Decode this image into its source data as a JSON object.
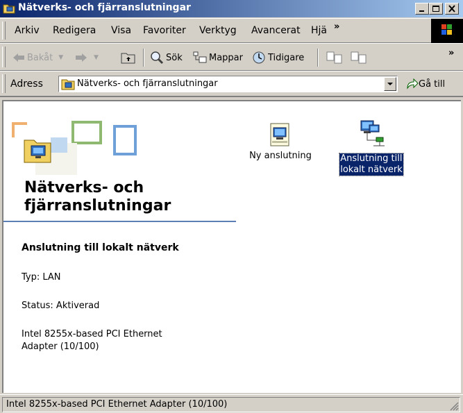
{
  "window": {
    "title": "Nätverks- och fjärranslutningar"
  },
  "menu": [
    "Arkiv",
    "Redigera",
    "Visa",
    "Favoriter",
    "Verktyg",
    "Avancerat",
    "Hjä"
  ],
  "toolbar": {
    "back": "Bakåt",
    "search": "Sök",
    "folders": "Mappar",
    "history": "Tidigare"
  },
  "address": {
    "label": "Adress",
    "value": "Nätverks- och fjärranslutningar",
    "go": "Gå till"
  },
  "panel": {
    "title_line1": "Nätverks- och",
    "title_line2": "fjärranslutningar",
    "selected_name": "Anslutning till lokalt nätverk",
    "type": "Typ: LAN",
    "status": "Status: Aktiverad",
    "device_line1": "Intel 8255x-based PCI Ethernet",
    "device_line2": "Adapter (10/100)"
  },
  "items": [
    {
      "label": "Ny anslutning",
      "icon": "new-connection-icon",
      "selected": false
    },
    {
      "label_line1": "Anslutning till",
      "label_line2": "lokalt nätverk",
      "icon": "lan-connection-icon",
      "selected": true
    }
  ],
  "statusbar": {
    "text": "Intel 8255x-based PCI Ethernet Adapter (10/100)"
  },
  "colors": {
    "titlebar_start": "#0a246a",
    "titlebar_end": "#a6caf0",
    "selection": "#0a246a",
    "chrome": "#d4d0c8"
  }
}
